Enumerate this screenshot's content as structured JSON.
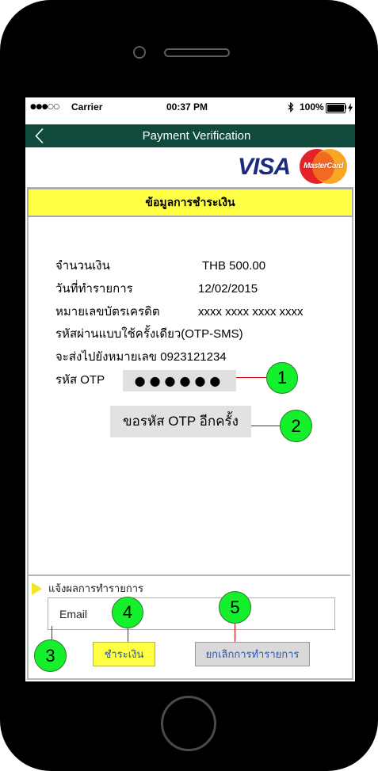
{
  "status_bar": {
    "signal": "●●●○○",
    "carrier": "Carrier",
    "time": "00:37 PM",
    "battery_level": "100%",
    "icons": [
      "bluetooth-icon",
      "battery-icon",
      "charging-bolt-icon"
    ]
  },
  "nav_bar": {
    "back_icon": "chevron-left-icon",
    "title": "Payment Verification"
  },
  "card_logos": {
    "visa": "VISA",
    "mastercard": "MasterCard"
  },
  "payment_info": {
    "header": "ข้อมูลการชำระเงิน",
    "rows": [
      {
        "label": "จำนวนเงิน",
        "value": "THB 500.00"
      },
      {
        "label": "วันที่ทำรายการ",
        "value": "12/02/2015"
      },
      {
        "label": "หมายเลขบัตรเครดิต",
        "value": "xxxx xxxx xxxx xxxx"
      }
    ],
    "otp_notice": [
      "รหัสผ่านแบบใช้ครั้งเดียว(OTP-SMS)",
      "จะส่งไปยังหมายเลข 0923121234"
    ],
    "otp_label": "รหัส OTP",
    "otp_value": "●●●●●●",
    "resend_button": "ขอรหัส OTP อีกครั้ง"
  },
  "notification": {
    "icon": "triangle-right-icon",
    "label": "แจ้งผลการทำรายการ",
    "email_placeholder": "Email"
  },
  "actions": {
    "pay_button": "ชำระเงิน",
    "cancel_button": "ยกเลิกการทำรายการ"
  },
  "annotation_markers": [
    "1",
    "2",
    "3",
    "4",
    "5"
  ],
  "colors": {
    "nav_bar": "#0f4a3c",
    "highlight_yellow": "#ffff44",
    "marker_green": "#14f02c",
    "connector_red": "#d40000",
    "button_text_blue": "#2255cc"
  }
}
